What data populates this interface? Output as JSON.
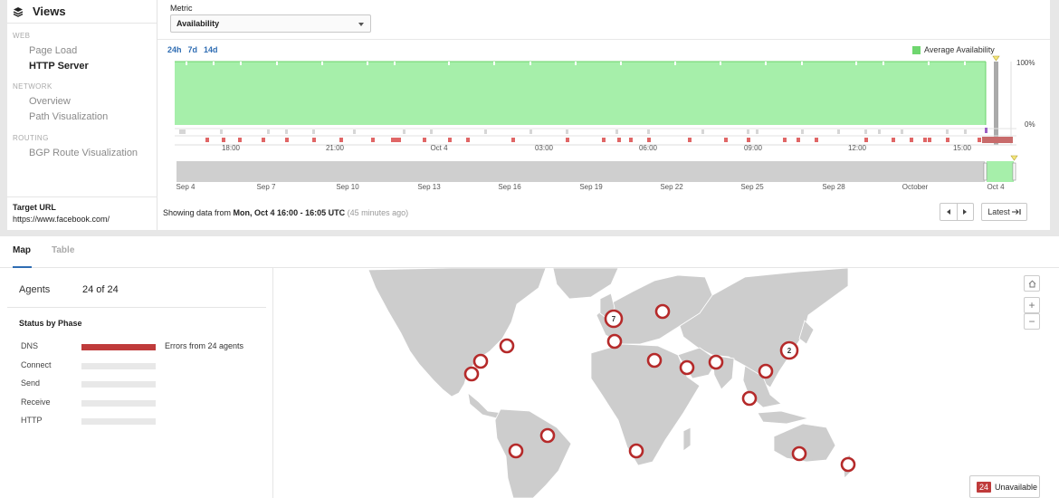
{
  "sidebar": {
    "title": "Views",
    "sections": [
      {
        "heading": "WEB",
        "items": [
          "Page Load",
          "HTTP Server"
        ]
      },
      {
        "heading": "NETWORK",
        "items": [
          "Overview",
          "Path Visualization"
        ]
      },
      {
        "heading": "ROUTING",
        "items": [
          "BGP Route Visualization"
        ]
      }
    ],
    "active_item": "HTTP Server",
    "target_label": "Target URL",
    "target_url": "https://www.facebook.com/"
  },
  "metric": {
    "label": "Metric",
    "selected": "Availability"
  },
  "time_ranges": [
    "24h",
    "7d",
    "14d"
  ],
  "legend": {
    "label": "Average Availability",
    "color": "#6fd66f"
  },
  "availability_chart": {
    "y_ticks": [
      "100%",
      "0%"
    ],
    "x_ticks": [
      "18:00",
      "21:00",
      "Oct 4",
      "03:00",
      "06:00",
      "09:00",
      "12:00",
      "15:00"
    ],
    "fill_color": "#a6efaa",
    "line_color": "#6bd36b",
    "error_color": "#e06666"
  },
  "timeline": {
    "x_ticks": [
      "Sep 4",
      "Sep 7",
      "Sep 10",
      "Sep 13",
      "Sep 16",
      "Sep 19",
      "Sep 22",
      "Sep 25",
      "Sep 28",
      "October",
      "Oct 4"
    ]
  },
  "status": {
    "prefix": "Showing data from ",
    "range": "Mon, Oct 4 16:00 - 16:05 UTC",
    "ago": "(45 minutes ago)"
  },
  "latest_button": "Latest",
  "tabs": [
    "Map",
    "Table"
  ],
  "agents": {
    "label": "Agents",
    "value": "24 of 24"
  },
  "status_by_phase": {
    "title": "Status by Phase",
    "phases": [
      {
        "name": "DNS",
        "error": true,
        "note": "Errors from 24 agents"
      },
      {
        "name": "Connect",
        "error": false,
        "note": ""
      },
      {
        "name": "Send",
        "error": false,
        "note": ""
      },
      {
        "name": "Receive",
        "error": false,
        "note": ""
      },
      {
        "name": "HTTP",
        "error": false,
        "note": ""
      }
    ],
    "error_color": "#bf3b3b"
  },
  "map_markers": [
    {
      "label": ""
    },
    {
      "label": ""
    },
    {
      "label": ""
    },
    {
      "label": "7"
    },
    {
      "label": ""
    },
    {
      "label": ""
    },
    {
      "label": ""
    },
    {
      "label": ""
    },
    {
      "label": ""
    },
    {
      "label": "2"
    },
    {
      "label": ""
    },
    {
      "label": ""
    },
    {
      "label": ""
    },
    {
      "label": ""
    },
    {
      "label": ""
    },
    {
      "label": ""
    },
    {
      "label": ""
    }
  ],
  "unavailable": {
    "count": "24",
    "label": "Unavailable"
  },
  "icons": [
    "layers-icon",
    "chevron-left-icon",
    "chevron-right-icon",
    "latest-icon",
    "home-icon",
    "zoom-in-icon",
    "zoom-out-icon"
  ]
}
